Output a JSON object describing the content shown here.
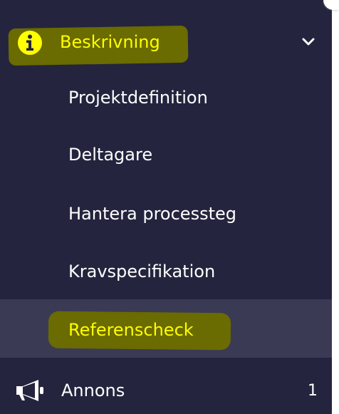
{
  "nav": {
    "section": {
      "label": "Beskrivning",
      "icon": "info-icon",
      "expanded": true,
      "toggle_icon": "chevron-down-icon"
    },
    "sub_items": [
      {
        "label": "Projektdefinition",
        "active": false
      },
      {
        "label": "Deltagare",
        "active": false
      },
      {
        "label": "Hantera processteg",
        "active": false
      },
      {
        "label": "Kravspecifikation",
        "active": false
      },
      {
        "label": "Referenscheck",
        "active": true
      }
    ],
    "next_section": {
      "label": "Annons",
      "icon": "megaphone-icon",
      "count": "1"
    }
  },
  "colors": {
    "sidebar_bg": "#24243e",
    "active_bg": "#3a3a55",
    "highlight": "#ffff00",
    "highlight_marker": "#6a6b00",
    "text": "#ffffff"
  }
}
